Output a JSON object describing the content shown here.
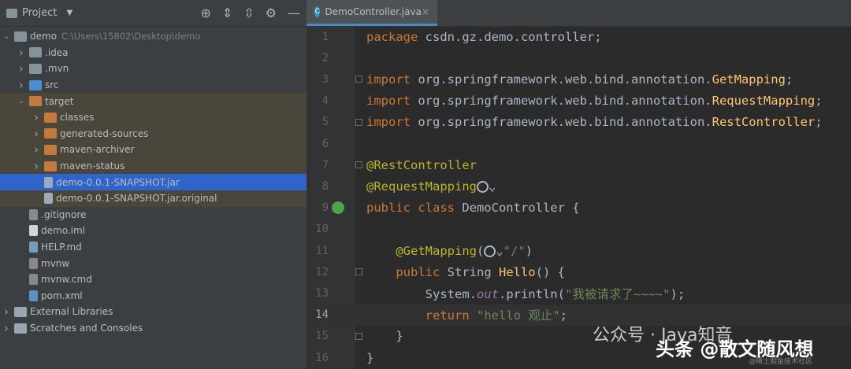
{
  "project_panel": {
    "title": "Project",
    "tree": [
      {
        "label": "demo",
        "path": "C:\\Users\\15802\\Desktop\\demo",
        "indent": 0,
        "arrow": "down",
        "icon": "folder",
        "state": "normal"
      },
      {
        "label": ".idea",
        "indent": 1,
        "arrow": "right",
        "icon": "folder",
        "state": "normal"
      },
      {
        "label": ".mvn",
        "indent": 1,
        "arrow": "right",
        "icon": "folder",
        "state": "normal"
      },
      {
        "label": "src",
        "indent": 1,
        "arrow": "right",
        "icon": "folder-src",
        "state": "normal"
      },
      {
        "label": "target",
        "indent": 1,
        "arrow": "down",
        "icon": "folder-orange",
        "state": "excluded"
      },
      {
        "label": "classes",
        "indent": 2,
        "arrow": "right",
        "icon": "folder-orange",
        "state": "excluded"
      },
      {
        "label": "generated-sources",
        "indent": 2,
        "arrow": "right",
        "icon": "folder-orange",
        "state": "excluded"
      },
      {
        "label": "maven-archiver",
        "indent": 2,
        "arrow": "right",
        "icon": "folder-orange",
        "state": "excluded"
      },
      {
        "label": "maven-status",
        "indent": 2,
        "arrow": "right",
        "icon": "folder-orange",
        "state": "excluded"
      },
      {
        "label": "demo-0.0.1-SNAPSHOT.jar",
        "indent": 2,
        "arrow": "",
        "icon": "file-jar",
        "state": "selected"
      },
      {
        "label": "demo-0.0.1-SNAPSHOT.jar.original",
        "indent": 2,
        "arrow": "",
        "icon": "file-jar",
        "state": "excluded"
      },
      {
        "label": ".gitignore",
        "indent": 1,
        "arrow": "",
        "icon": "file-git",
        "state": "normal"
      },
      {
        "label": "demo.iml",
        "indent": 1,
        "arrow": "",
        "icon": "file",
        "state": "normal"
      },
      {
        "label": "HELP.md",
        "indent": 1,
        "arrow": "",
        "icon": "file-md",
        "state": "normal"
      },
      {
        "label": "mvnw",
        "indent": 1,
        "arrow": "",
        "icon": "file-cmd",
        "state": "normal"
      },
      {
        "label": "mvnw.cmd",
        "indent": 1,
        "arrow": "",
        "icon": "file-cmd",
        "state": "normal"
      },
      {
        "label": "pom.xml",
        "indent": 1,
        "arrow": "",
        "icon": "file-pom",
        "state": "normal"
      },
      {
        "label": "External Libraries",
        "indent": 0,
        "arrow": "right",
        "icon": "lib",
        "state": "normal"
      },
      {
        "label": "Scratches and Consoles",
        "indent": 0,
        "arrow": "right",
        "icon": "lib",
        "state": "normal"
      }
    ]
  },
  "editor": {
    "tab_label": "DemoController.java",
    "current_line": 14
  },
  "watermark": {
    "line1": "公众号 · Java知音",
    "line2": "头条 @散文随风想",
    "line3": "@稀土掘金技术社区"
  }
}
